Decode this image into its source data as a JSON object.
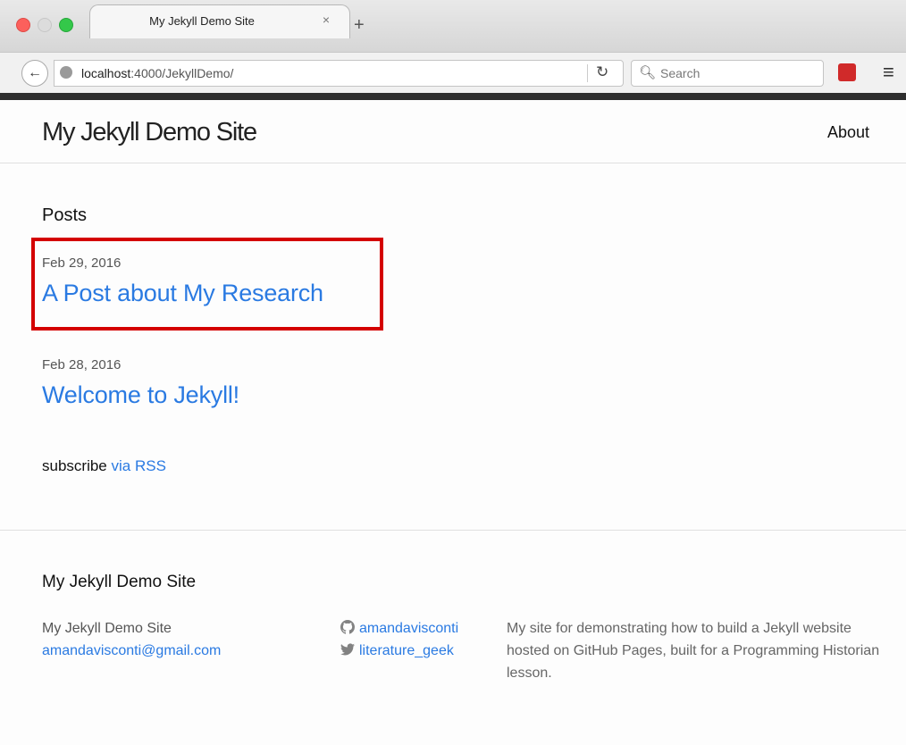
{
  "browser": {
    "tab_title": "My Jekyll Demo Site",
    "tab_close": "×",
    "new_tab": "+",
    "url_host": "localhost",
    "url_path": ":4000/JekyllDemo/",
    "search_placeholder": "Search"
  },
  "site": {
    "title": "My Jekyll Demo Site",
    "nav_about": "About"
  },
  "posts": {
    "heading": "Posts",
    "items": [
      {
        "date": "Feb 29, 2016",
        "title": "A Post about My Research"
      },
      {
        "date": "Feb 28, 2016",
        "title": "Welcome to Jekyll!"
      }
    ]
  },
  "subscribe": {
    "label": "subscribe",
    "link": "via RSS"
  },
  "footer": {
    "heading": "My Jekyll Demo Site",
    "name": "My Jekyll Demo Site",
    "email": "amandavisconti@gmail.com",
    "github": "amandavisconti",
    "twitter": "literature_geek",
    "description": "My site for demonstrating how to build a Jekyll website hosted on GitHub Pages, built for a Programming Historian lesson."
  },
  "colors": {
    "link": "#2a7ae2",
    "highlight": "#d40000"
  }
}
